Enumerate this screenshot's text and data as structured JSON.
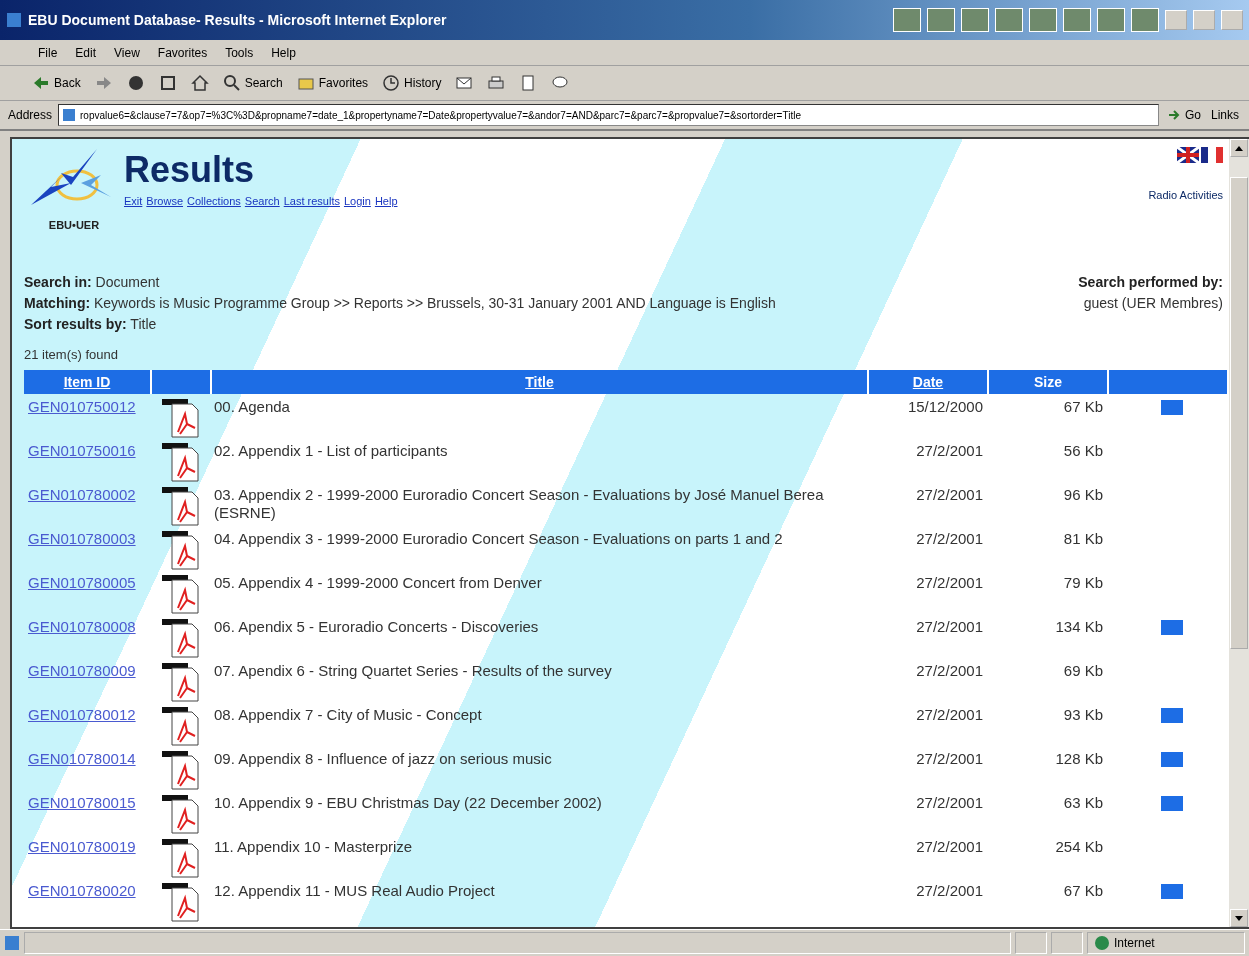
{
  "window": {
    "title": "EBU Document Database- Results - Microsoft Internet Explorer"
  },
  "menu": [
    "File",
    "Edit",
    "View",
    "Favorites",
    "Tools",
    "Help"
  ],
  "toolbar": [
    {
      "kind": "back",
      "label": "Back"
    },
    {
      "kind": "forward"
    },
    {
      "kind": "stop"
    },
    {
      "kind": "refresh"
    },
    {
      "kind": "home"
    },
    {
      "kind": "search",
      "label": "Search"
    },
    {
      "kind": "favorites",
      "label": "Favorites"
    },
    {
      "kind": "history",
      "label": "History"
    },
    {
      "kind": "mail"
    },
    {
      "kind": "print"
    },
    {
      "kind": "edit"
    },
    {
      "kind": "discuss"
    }
  ],
  "address_bar": {
    "label": "Address",
    "value": "ropvalue6=&clause7=7&op7=%3C%3D&propname7=date_1&propertyname7=Date&propertyvalue7=&andor7=AND&parc7=&parc7=&propvalue7=&sortorder=Title",
    "go": "Go",
    "links": "Links"
  },
  "page": {
    "heading": "Results",
    "logo_text": "EBU•UER",
    "nav": [
      "Exit",
      "Browse",
      "Collections",
      "Search",
      "Last results",
      "Login",
      "Help"
    ],
    "section": "Radio Activities",
    "search_in": {
      "label": "Search in:",
      "value": "Document"
    },
    "matching": {
      "label": "Matching:",
      "value": "Keywords is Music Programme Group >> Reports >> Brussels, 30-31 January 2001 AND Language is English"
    },
    "sort": {
      "label": "Sort results by:",
      "value": "Title"
    },
    "performed_by": {
      "label": "Search performed by:",
      "value": "guest (UER Membres)"
    },
    "count": "21 item(s) found"
  },
  "table": {
    "columns": [
      {
        "label": "Item ID",
        "link": true
      },
      {
        "label": "Title",
        "link": true
      },
      {
        "label": "Date",
        "link": true
      },
      {
        "label": "Size",
        "link": false
      }
    ],
    "rows": [
      {
        "id": "GEN010750012",
        "title": "00. Agenda",
        "date": "15/12/2000",
        "size": "67 Kb",
        "flagged": true
      },
      {
        "id": "GEN010750016",
        "title": "02. Appendix 1 - List of participants",
        "date": "27/2/2001",
        "size": "56 Kb",
        "flagged": false
      },
      {
        "id": "GEN010780002",
        "title": "03. Appendix 2 - 1999-2000 Euroradio Concert Season - Evaluations by José Manuel Berea (ESRNE)",
        "date": "27/2/2001",
        "size": "96 Kb",
        "flagged": false
      },
      {
        "id": "GEN010780003",
        "title": "04. Appendix 3 - 1999-2000 Euroradio Concert Season - Evaluations on parts 1 and 2",
        "date": "27/2/2001",
        "size": "81 Kb",
        "flagged": false
      },
      {
        "id": "GEN010780005",
        "title": "05. Appendix 4 - 1999-2000 Concert from Denver",
        "date": "27/2/2001",
        "size": "79 Kb",
        "flagged": false
      },
      {
        "id": "GEN010780008",
        "title": "06. Apendix 5 - Euroradio Concerts - Discoveries",
        "date": "27/2/2001",
        "size": "134 Kb",
        "flagged": true
      },
      {
        "id": "GEN010780009",
        "title": "07. Apendix 6 - String Quartet Series - Results of the survey",
        "date": "27/2/2001",
        "size": "69 Kb",
        "flagged": false
      },
      {
        "id": "GEN010780012",
        "title": "08. Appendix 7 - City of Music - Concept",
        "date": "27/2/2001",
        "size": "93 Kb",
        "flagged": true
      },
      {
        "id": "GEN010780014",
        "title": "09. Appendix 8 - Influence of jazz on serious music",
        "date": "27/2/2001",
        "size": "128 Kb",
        "flagged": true
      },
      {
        "id": "GEN010780015",
        "title": "10. Appendix 9 - EBU Christmas Day (22 December 2002)",
        "date": "27/2/2001",
        "size": "63 Kb",
        "flagged": true
      },
      {
        "id": "GEN010780019",
        "title": "11. Appendix 10 - Masterprize",
        "date": "27/2/2001",
        "size": "254 Kb",
        "flagged": false
      },
      {
        "id": "GEN010780020",
        "title": "12. Appendix 11 - MUS Real Audio Project",
        "date": "27/2/2001",
        "size": "67 Kb",
        "flagged": true
      }
    ]
  },
  "status_bar": {
    "zone": "Internet"
  }
}
